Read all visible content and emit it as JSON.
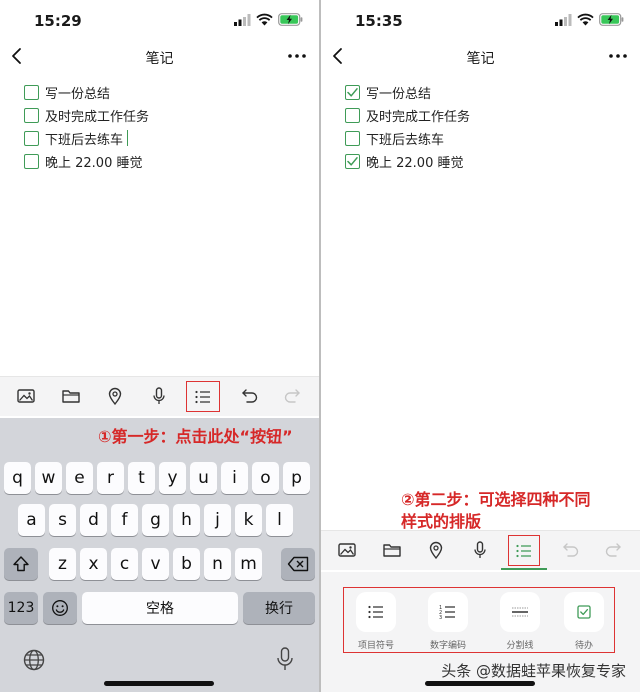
{
  "left": {
    "status_time": "15:29",
    "title": "笔记",
    "todos": [
      {
        "text": "写一份总结",
        "checked": false
      },
      {
        "text": "及时完成工作任务",
        "checked": false
      },
      {
        "text": "下班后去练车",
        "checked": false
      },
      {
        "text": "晚上 22.00 睡觉",
        "checked": false
      }
    ],
    "annotation": "①第一步：点击此处“按钮”",
    "keyboard": {
      "row1": [
        "q",
        "w",
        "e",
        "r",
        "t",
        "y",
        "u",
        "i",
        "o",
        "p"
      ],
      "row2": [
        "a",
        "s",
        "d",
        "f",
        "g",
        "h",
        "j",
        "k",
        "l"
      ],
      "row3": [
        "z",
        "x",
        "c",
        "v",
        "b",
        "n",
        "m"
      ],
      "numbers_key": "123",
      "space_key": "空格",
      "return_key": "换行"
    }
  },
  "right": {
    "status_time": "15:35",
    "title": "笔记",
    "todos": [
      {
        "text": "写一份总结",
        "checked": true
      },
      {
        "text": "及时完成工作任务",
        "checked": false
      },
      {
        "text": "下班后去练车",
        "checked": false
      },
      {
        "text": "晚上 22.00 睡觉",
        "checked": true
      }
    ],
    "annotation_line1": "②第二步：可选择四种不同",
    "annotation_line2": "样式的排版",
    "styles": [
      {
        "label": "项目符号",
        "icon": "bullet-list-icon"
      },
      {
        "label": "数字编码",
        "icon": "numbered-list-icon"
      },
      {
        "label": "分割线",
        "icon": "divider-line-icon"
      },
      {
        "label": "待办",
        "icon": "checkbox-icon"
      }
    ]
  },
  "watermark": "头条 @数据蛙苹果恢复专家",
  "colors": {
    "accent_green": "#3f9b57",
    "annotation_red": "#d62828",
    "keyboard_bg": "#d3d5da",
    "toolbar_bg": "#f4f4f5"
  }
}
